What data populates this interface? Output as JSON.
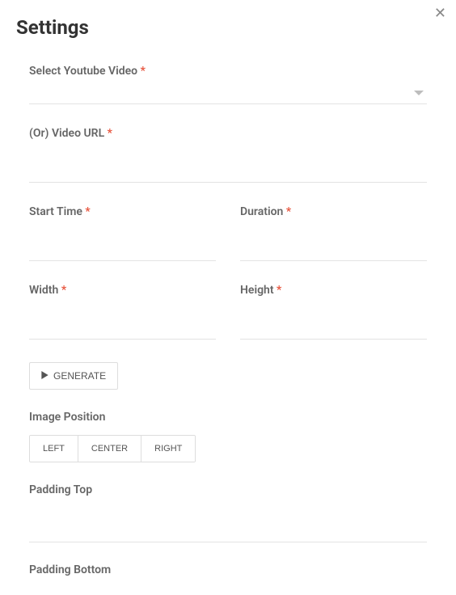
{
  "header": {
    "title": "Settings"
  },
  "fields": {
    "select_video": {
      "label": "Select Youtube Video",
      "required": "*",
      "value": ""
    },
    "video_url": {
      "label": "(Or) Video URL",
      "required": "*",
      "value": ""
    },
    "start_time": {
      "label": "Start Time",
      "required": "*",
      "value": ""
    },
    "duration": {
      "label": "Duration",
      "required": "*",
      "value": ""
    },
    "width": {
      "label": "Width",
      "required": "*",
      "value": ""
    },
    "height": {
      "label": "Height",
      "required": "*",
      "value": ""
    },
    "generate_label": "GENERATE",
    "image_position": {
      "label": "Image Position",
      "options": {
        "left": "LEFT",
        "center": "CENTER",
        "right": "RIGHT"
      }
    },
    "padding_top": {
      "label": "Padding Top",
      "value": ""
    },
    "padding_bottom": {
      "label": "Padding Bottom",
      "value": ""
    }
  }
}
